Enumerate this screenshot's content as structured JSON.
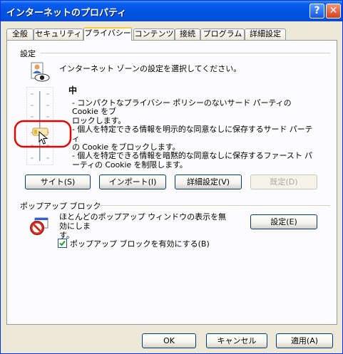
{
  "window": {
    "title": "インターネットのプロパティ",
    "help_label": "?",
    "close_label": "✕"
  },
  "tabs": [
    {
      "label": "全般"
    },
    {
      "label": "セキュリティ"
    },
    {
      "label": "プライバシー",
      "active": true
    },
    {
      "label": "コンテンツ"
    },
    {
      "label": "接続"
    },
    {
      "label": "プログラム"
    },
    {
      "label": "詳細設定"
    }
  ],
  "settings": {
    "group_label": "設定",
    "zone_text": "インターネット ゾーンの設定を選択してください。",
    "level_title": "中",
    "description": "- コンパクトなプライバシー ポリシーのないサード パーティの Cookie をブ\nロックします。\n- 個人を特定できる情報を明示的な同意なしに保存するサード パーティ\nの Cookie をブロックします。\n- 個人を特定できる情報を暗黙的な同意なしに保存するファースト パ\nーティの Cookie を制限します。",
    "slider_level": "中",
    "buttons": {
      "sites": "サイト(S)",
      "import": "インポート(I)",
      "advanced": "詳細設定(V)",
      "default": "既定(D)"
    }
  },
  "popup": {
    "group_label": "ポップアップ ブロック",
    "text": "ほとんどのポップアップ ウィンドウの表示を無効にしま\nす。",
    "settings_button": "設定(E)",
    "checkbox_label": "ポップアップ ブロックを有効にする(B)",
    "checkbox_checked": true
  },
  "footer": {
    "ok": "OK",
    "cancel": "キャンセル",
    "apply": "適用(A)"
  },
  "icons": {
    "zone": "internet-zone-icon",
    "popup": "popup-blocker-icon",
    "cursor": "mouse-cursor-icon"
  },
  "colors": {
    "titlebar": "#0054e3",
    "highlight_circle": "#e00000",
    "active_tab_accent": "#ffc83c"
  }
}
